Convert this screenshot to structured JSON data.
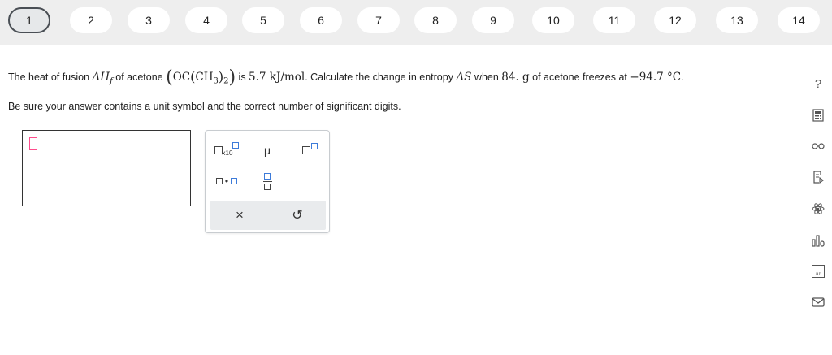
{
  "steps": [
    "1",
    "2",
    "3",
    "4",
    "5",
    "6",
    "7",
    "8",
    "9",
    "10",
    "11",
    "12",
    "13",
    "14"
  ],
  "active_step": "1",
  "problem": {
    "p1": "The heat of fusion ",
    "dH": "ΔH",
    "sub_f": "f",
    "p2": " of acetone ",
    "f_oc": "OC",
    "f_ch": "CH",
    "f_sub3": "3",
    "f_sub2": "2",
    "p3": " is ",
    "val1": "5.7 kJ/mol",
    "p4": ". Calculate the change in entropy ",
    "dS": "ΔS",
    "p5": " when ",
    "val2": "84. g",
    "p6": " of acetone freezes at ",
    "val3": "−94.7 °C",
    "p7": "."
  },
  "note": "Be sure your answer contains a unit symbol and the correct number of significant digits.",
  "palette": {
    "x10_label": "x10",
    "mu_label": "μ",
    "clear_label": "×",
    "undo_label": "↺"
  },
  "sidebar_icons": [
    "help-icon",
    "calculator-icon",
    "glasses-icon",
    "data-icon",
    "atom-icon",
    "chart-icon",
    "periodic-table-icon",
    "mail-icon"
  ],
  "sidebar": {
    "help": "?",
    "periodic": "Ar"
  }
}
